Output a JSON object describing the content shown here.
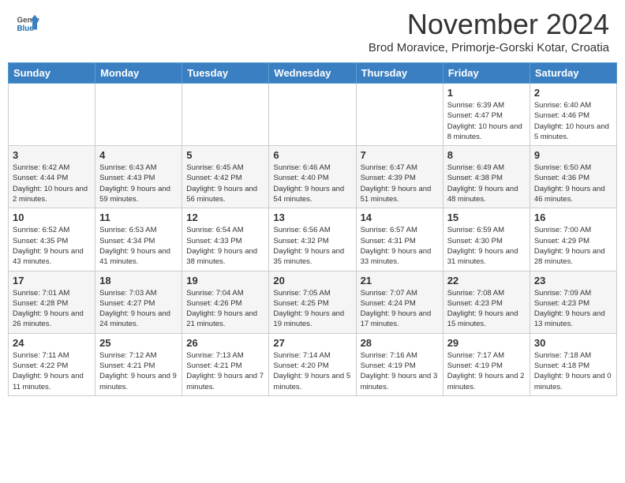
{
  "header": {
    "logo_general": "General",
    "logo_blue": "Blue",
    "month_title": "November 2024",
    "subtitle": "Brod Moravice, Primorje-Gorski Kotar, Croatia"
  },
  "weekdays": [
    "Sunday",
    "Monday",
    "Tuesday",
    "Wednesday",
    "Thursday",
    "Friday",
    "Saturday"
  ],
  "weeks": [
    [
      {
        "day": "",
        "sunrise": "",
        "sunset": "",
        "daylight": ""
      },
      {
        "day": "",
        "sunrise": "",
        "sunset": "",
        "daylight": ""
      },
      {
        "day": "",
        "sunrise": "",
        "sunset": "",
        "daylight": ""
      },
      {
        "day": "",
        "sunrise": "",
        "sunset": "",
        "daylight": ""
      },
      {
        "day": "",
        "sunrise": "",
        "sunset": "",
        "daylight": ""
      },
      {
        "day": "1",
        "sunrise": "Sunrise: 6:39 AM",
        "sunset": "Sunset: 4:47 PM",
        "daylight": "Daylight: 10 hours and 8 minutes."
      },
      {
        "day": "2",
        "sunrise": "Sunrise: 6:40 AM",
        "sunset": "Sunset: 4:46 PM",
        "daylight": "Daylight: 10 hours and 5 minutes."
      }
    ],
    [
      {
        "day": "3",
        "sunrise": "Sunrise: 6:42 AM",
        "sunset": "Sunset: 4:44 PM",
        "daylight": "Daylight: 10 hours and 2 minutes."
      },
      {
        "day": "4",
        "sunrise": "Sunrise: 6:43 AM",
        "sunset": "Sunset: 4:43 PM",
        "daylight": "Daylight: 9 hours and 59 minutes."
      },
      {
        "day": "5",
        "sunrise": "Sunrise: 6:45 AM",
        "sunset": "Sunset: 4:42 PM",
        "daylight": "Daylight: 9 hours and 56 minutes."
      },
      {
        "day": "6",
        "sunrise": "Sunrise: 6:46 AM",
        "sunset": "Sunset: 4:40 PM",
        "daylight": "Daylight: 9 hours and 54 minutes."
      },
      {
        "day": "7",
        "sunrise": "Sunrise: 6:47 AM",
        "sunset": "Sunset: 4:39 PM",
        "daylight": "Daylight: 9 hours and 51 minutes."
      },
      {
        "day": "8",
        "sunrise": "Sunrise: 6:49 AM",
        "sunset": "Sunset: 4:38 PM",
        "daylight": "Daylight: 9 hours and 48 minutes."
      },
      {
        "day": "9",
        "sunrise": "Sunrise: 6:50 AM",
        "sunset": "Sunset: 4:36 PM",
        "daylight": "Daylight: 9 hours and 46 minutes."
      }
    ],
    [
      {
        "day": "10",
        "sunrise": "Sunrise: 6:52 AM",
        "sunset": "Sunset: 4:35 PM",
        "daylight": "Daylight: 9 hours and 43 minutes."
      },
      {
        "day": "11",
        "sunrise": "Sunrise: 6:53 AM",
        "sunset": "Sunset: 4:34 PM",
        "daylight": "Daylight: 9 hours and 41 minutes."
      },
      {
        "day": "12",
        "sunrise": "Sunrise: 6:54 AM",
        "sunset": "Sunset: 4:33 PM",
        "daylight": "Daylight: 9 hours and 38 minutes."
      },
      {
        "day": "13",
        "sunrise": "Sunrise: 6:56 AM",
        "sunset": "Sunset: 4:32 PM",
        "daylight": "Daylight: 9 hours and 35 minutes."
      },
      {
        "day": "14",
        "sunrise": "Sunrise: 6:57 AM",
        "sunset": "Sunset: 4:31 PM",
        "daylight": "Daylight: 9 hours and 33 minutes."
      },
      {
        "day": "15",
        "sunrise": "Sunrise: 6:59 AM",
        "sunset": "Sunset: 4:30 PM",
        "daylight": "Daylight: 9 hours and 31 minutes."
      },
      {
        "day": "16",
        "sunrise": "Sunrise: 7:00 AM",
        "sunset": "Sunset: 4:29 PM",
        "daylight": "Daylight: 9 hours and 28 minutes."
      }
    ],
    [
      {
        "day": "17",
        "sunrise": "Sunrise: 7:01 AM",
        "sunset": "Sunset: 4:28 PM",
        "daylight": "Daylight: 9 hours and 26 minutes."
      },
      {
        "day": "18",
        "sunrise": "Sunrise: 7:03 AM",
        "sunset": "Sunset: 4:27 PM",
        "daylight": "Daylight: 9 hours and 24 minutes."
      },
      {
        "day": "19",
        "sunrise": "Sunrise: 7:04 AM",
        "sunset": "Sunset: 4:26 PM",
        "daylight": "Daylight: 9 hours and 21 minutes."
      },
      {
        "day": "20",
        "sunrise": "Sunrise: 7:05 AM",
        "sunset": "Sunset: 4:25 PM",
        "daylight": "Daylight: 9 hours and 19 minutes."
      },
      {
        "day": "21",
        "sunrise": "Sunrise: 7:07 AM",
        "sunset": "Sunset: 4:24 PM",
        "daylight": "Daylight: 9 hours and 17 minutes."
      },
      {
        "day": "22",
        "sunrise": "Sunrise: 7:08 AM",
        "sunset": "Sunset: 4:23 PM",
        "daylight": "Daylight: 9 hours and 15 minutes."
      },
      {
        "day": "23",
        "sunrise": "Sunrise: 7:09 AM",
        "sunset": "Sunset: 4:23 PM",
        "daylight": "Daylight: 9 hours and 13 minutes."
      }
    ],
    [
      {
        "day": "24",
        "sunrise": "Sunrise: 7:11 AM",
        "sunset": "Sunset: 4:22 PM",
        "daylight": "Daylight: 9 hours and 11 minutes."
      },
      {
        "day": "25",
        "sunrise": "Sunrise: 7:12 AM",
        "sunset": "Sunset: 4:21 PM",
        "daylight": "Daylight: 9 hours and 9 minutes."
      },
      {
        "day": "26",
        "sunrise": "Sunrise: 7:13 AM",
        "sunset": "Sunset: 4:21 PM",
        "daylight": "Daylight: 9 hours and 7 minutes."
      },
      {
        "day": "27",
        "sunrise": "Sunrise: 7:14 AM",
        "sunset": "Sunset: 4:20 PM",
        "daylight": "Daylight: 9 hours and 5 minutes."
      },
      {
        "day": "28",
        "sunrise": "Sunrise: 7:16 AM",
        "sunset": "Sunset: 4:19 PM",
        "daylight": "Daylight: 9 hours and 3 minutes."
      },
      {
        "day": "29",
        "sunrise": "Sunrise: 7:17 AM",
        "sunset": "Sunset: 4:19 PM",
        "daylight": "Daylight: 9 hours and 2 minutes."
      },
      {
        "day": "30",
        "sunrise": "Sunrise: 7:18 AM",
        "sunset": "Sunset: 4:18 PM",
        "daylight": "Daylight: 9 hours and 0 minutes."
      }
    ]
  ]
}
